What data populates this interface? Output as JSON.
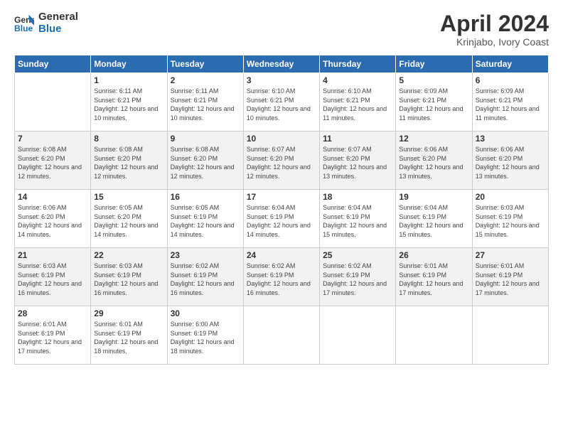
{
  "header": {
    "logo_line1": "General",
    "logo_line2": "Blue",
    "month": "April 2024",
    "location": "Krinjabo, Ivory Coast"
  },
  "weekdays": [
    "Sunday",
    "Monday",
    "Tuesday",
    "Wednesday",
    "Thursday",
    "Friday",
    "Saturday"
  ],
  "weeks": [
    [
      {
        "day": "",
        "sunrise": "",
        "sunset": "",
        "daylight": ""
      },
      {
        "day": "1",
        "sunrise": "Sunrise: 6:11 AM",
        "sunset": "Sunset: 6:21 PM",
        "daylight": "Daylight: 12 hours and 10 minutes."
      },
      {
        "day": "2",
        "sunrise": "Sunrise: 6:11 AM",
        "sunset": "Sunset: 6:21 PM",
        "daylight": "Daylight: 12 hours and 10 minutes."
      },
      {
        "day": "3",
        "sunrise": "Sunrise: 6:10 AM",
        "sunset": "Sunset: 6:21 PM",
        "daylight": "Daylight: 12 hours and 10 minutes."
      },
      {
        "day": "4",
        "sunrise": "Sunrise: 6:10 AM",
        "sunset": "Sunset: 6:21 PM",
        "daylight": "Daylight: 12 hours and 11 minutes."
      },
      {
        "day": "5",
        "sunrise": "Sunrise: 6:09 AM",
        "sunset": "Sunset: 6:21 PM",
        "daylight": "Daylight: 12 hours and 11 minutes."
      },
      {
        "day": "6",
        "sunrise": "Sunrise: 6:09 AM",
        "sunset": "Sunset: 6:21 PM",
        "daylight": "Daylight: 12 hours and 11 minutes."
      }
    ],
    [
      {
        "day": "7",
        "sunrise": "Sunrise: 6:08 AM",
        "sunset": "Sunset: 6:20 PM",
        "daylight": "Daylight: 12 hours and 12 minutes."
      },
      {
        "day": "8",
        "sunrise": "Sunrise: 6:08 AM",
        "sunset": "Sunset: 6:20 PM",
        "daylight": "Daylight: 12 hours and 12 minutes."
      },
      {
        "day": "9",
        "sunrise": "Sunrise: 6:08 AM",
        "sunset": "Sunset: 6:20 PM",
        "daylight": "Daylight: 12 hours and 12 minutes."
      },
      {
        "day": "10",
        "sunrise": "Sunrise: 6:07 AM",
        "sunset": "Sunset: 6:20 PM",
        "daylight": "Daylight: 12 hours and 12 minutes."
      },
      {
        "day": "11",
        "sunrise": "Sunrise: 6:07 AM",
        "sunset": "Sunset: 6:20 PM",
        "daylight": "Daylight: 12 hours and 13 minutes."
      },
      {
        "day": "12",
        "sunrise": "Sunrise: 6:06 AM",
        "sunset": "Sunset: 6:20 PM",
        "daylight": "Daylight: 12 hours and 13 minutes."
      },
      {
        "day": "13",
        "sunrise": "Sunrise: 6:06 AM",
        "sunset": "Sunset: 6:20 PM",
        "daylight": "Daylight: 12 hours and 13 minutes."
      }
    ],
    [
      {
        "day": "14",
        "sunrise": "Sunrise: 6:06 AM",
        "sunset": "Sunset: 6:20 PM",
        "daylight": "Daylight: 12 hours and 14 minutes."
      },
      {
        "day": "15",
        "sunrise": "Sunrise: 6:05 AM",
        "sunset": "Sunset: 6:20 PM",
        "daylight": "Daylight: 12 hours and 14 minutes."
      },
      {
        "day": "16",
        "sunrise": "Sunrise: 6:05 AM",
        "sunset": "Sunset: 6:19 PM",
        "daylight": "Daylight: 12 hours and 14 minutes."
      },
      {
        "day": "17",
        "sunrise": "Sunrise: 6:04 AM",
        "sunset": "Sunset: 6:19 PM",
        "daylight": "Daylight: 12 hours and 14 minutes."
      },
      {
        "day": "18",
        "sunrise": "Sunrise: 6:04 AM",
        "sunset": "Sunset: 6:19 PM",
        "daylight": "Daylight: 12 hours and 15 minutes."
      },
      {
        "day": "19",
        "sunrise": "Sunrise: 6:04 AM",
        "sunset": "Sunset: 6:19 PM",
        "daylight": "Daylight: 12 hours and 15 minutes."
      },
      {
        "day": "20",
        "sunrise": "Sunrise: 6:03 AM",
        "sunset": "Sunset: 6:19 PM",
        "daylight": "Daylight: 12 hours and 15 minutes."
      }
    ],
    [
      {
        "day": "21",
        "sunrise": "Sunrise: 6:03 AM",
        "sunset": "Sunset: 6:19 PM",
        "daylight": "Daylight: 12 hours and 16 minutes."
      },
      {
        "day": "22",
        "sunrise": "Sunrise: 6:03 AM",
        "sunset": "Sunset: 6:19 PM",
        "daylight": "Daylight: 12 hours and 16 minutes."
      },
      {
        "day": "23",
        "sunrise": "Sunrise: 6:02 AM",
        "sunset": "Sunset: 6:19 PM",
        "daylight": "Daylight: 12 hours and 16 minutes."
      },
      {
        "day": "24",
        "sunrise": "Sunrise: 6:02 AM",
        "sunset": "Sunset: 6:19 PM",
        "daylight": "Daylight: 12 hours and 16 minutes."
      },
      {
        "day": "25",
        "sunrise": "Sunrise: 6:02 AM",
        "sunset": "Sunset: 6:19 PM",
        "daylight": "Daylight: 12 hours and 17 minutes."
      },
      {
        "day": "26",
        "sunrise": "Sunrise: 6:01 AM",
        "sunset": "Sunset: 6:19 PM",
        "daylight": "Daylight: 12 hours and 17 minutes."
      },
      {
        "day": "27",
        "sunrise": "Sunrise: 6:01 AM",
        "sunset": "Sunset: 6:19 PM",
        "daylight": "Daylight: 12 hours and 17 minutes."
      }
    ],
    [
      {
        "day": "28",
        "sunrise": "Sunrise: 6:01 AM",
        "sunset": "Sunset: 6:19 PM",
        "daylight": "Daylight: 12 hours and 17 minutes."
      },
      {
        "day": "29",
        "sunrise": "Sunrise: 6:01 AM",
        "sunset": "Sunset: 6:19 PM",
        "daylight": "Daylight: 12 hours and 18 minutes."
      },
      {
        "day": "30",
        "sunrise": "Sunrise: 6:00 AM",
        "sunset": "Sunset: 6:19 PM",
        "daylight": "Daylight: 12 hours and 18 minutes."
      },
      {
        "day": "",
        "sunrise": "",
        "sunset": "",
        "daylight": ""
      },
      {
        "day": "",
        "sunrise": "",
        "sunset": "",
        "daylight": ""
      },
      {
        "day": "",
        "sunrise": "",
        "sunset": "",
        "daylight": ""
      },
      {
        "day": "",
        "sunrise": "",
        "sunset": "",
        "daylight": ""
      }
    ]
  ]
}
